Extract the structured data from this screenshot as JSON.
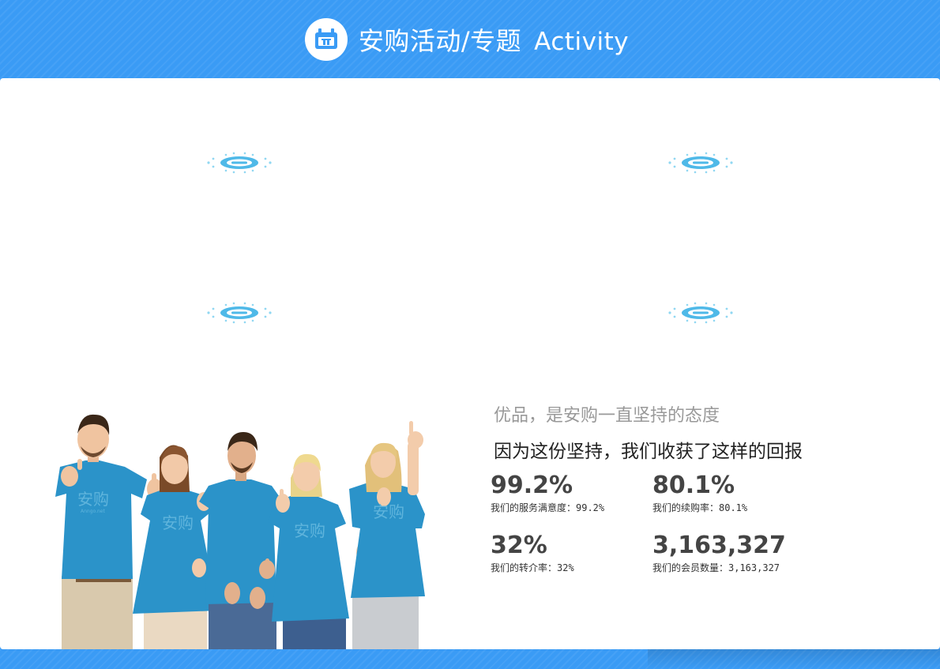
{
  "header": {
    "title": "安购活动/专题",
    "title_en": "Activity",
    "icon": "calendar-gift-icon"
  },
  "banners": [
    {
      "name": "activity-banner-1",
      "state": "loading"
    },
    {
      "name": "activity-banner-2",
      "state": "loading"
    },
    {
      "name": "activity-banner-3",
      "state": "loading"
    },
    {
      "name": "activity-banner-4",
      "state": "loading"
    }
  ],
  "team_photo": {
    "shirt_text": "安购",
    "shirt_subtext": "Anngo.net"
  },
  "stats": {
    "slogan_1": "优品，是安购一直坚持的态度",
    "slogan_2": "因为这份坚持，我们收获了这样的回报",
    "items": [
      {
        "value": "99.2%",
        "label": "我们的服务满意度：99.2%"
      },
      {
        "value": "80.1%",
        "label": "我们的续购率：80.1%"
      },
      {
        "value": "32%",
        "label": "我们的转介率：32%"
      },
      {
        "value": "3,163,327",
        "label": "我们的会员数量：3,163,327"
      }
    ]
  },
  "colors": {
    "brand_blue": "#3a9bf5",
    "shirt_blue": "#2b93c9",
    "loader_blue": "#7dd1f0"
  }
}
